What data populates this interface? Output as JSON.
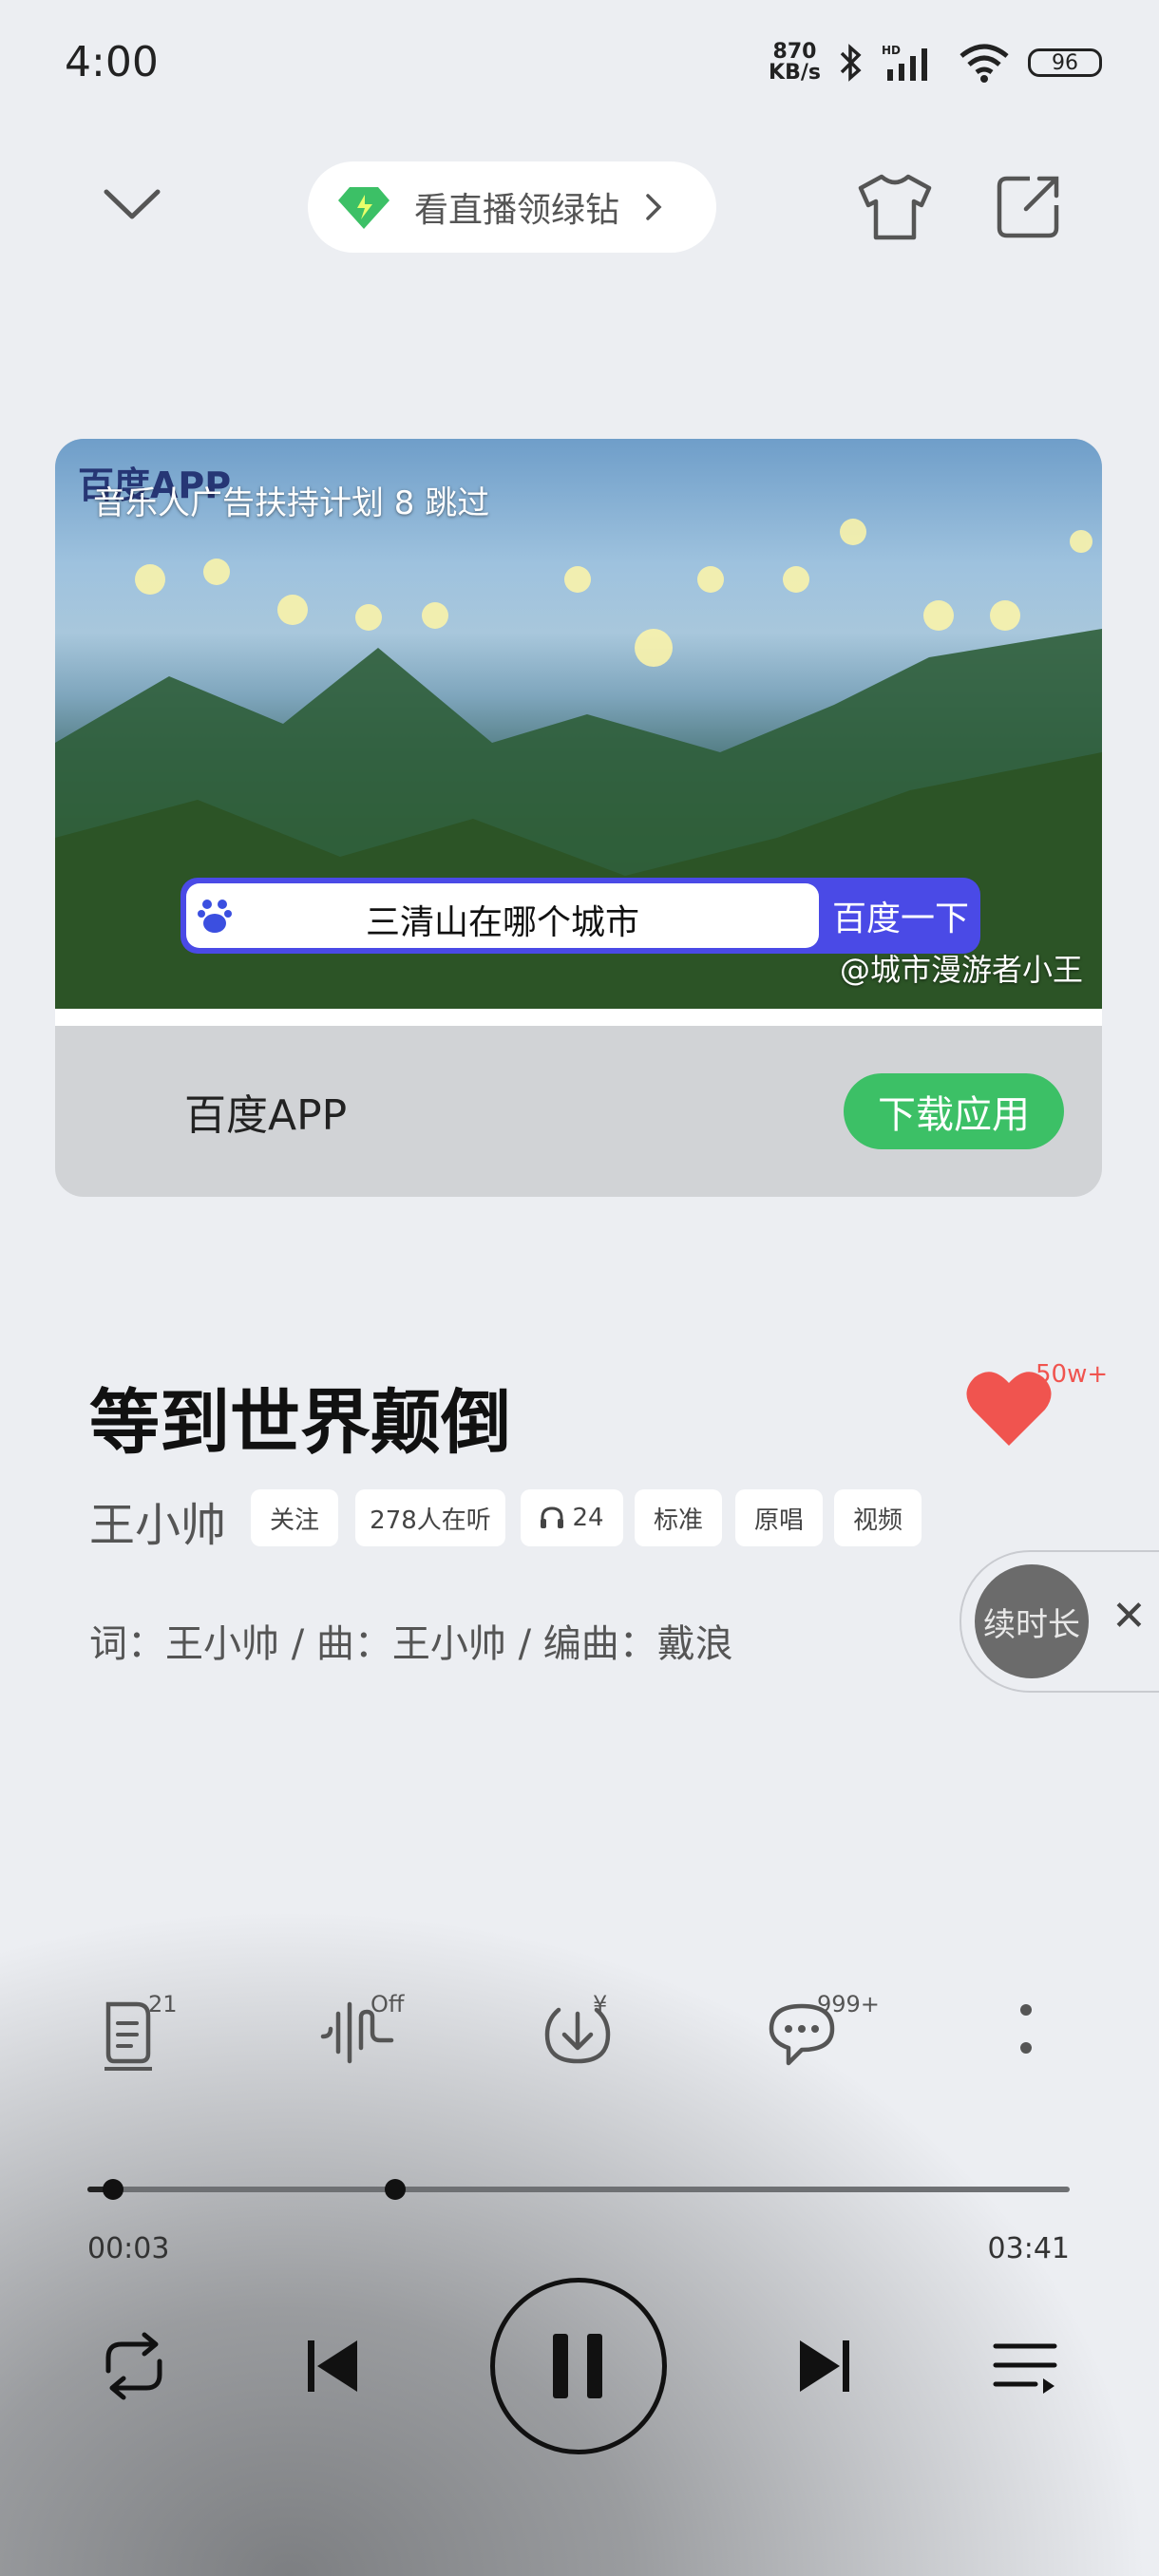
{
  "status_bar": {
    "time": "4:00",
    "speed_value": "870",
    "speed_unit": "KB/s",
    "battery": "96"
  },
  "top_bar": {
    "live_pill_label": "看直播领绿钻"
  },
  "ad": {
    "logo_text": "百度APP",
    "plan_label": "音乐人广告扶持计划 8  跳过",
    "search_query": "三清山在哪个城市",
    "search_button": "百度一下",
    "watermark": "@城市漫游者小王",
    "app_name": "百度APP",
    "download_button": "下载应用"
  },
  "song": {
    "title": "等到世界颠倒",
    "like_count": "50w+",
    "artist": "王小帅",
    "tags": [
      "关注",
      "278人在听",
      "24",
      "标准",
      "原唱",
      "视频"
    ],
    "credits": "词：王小帅 / 曲：王小帅 / 编曲：戴浪"
  },
  "extend_button": {
    "label": "续时长"
  },
  "actions": {
    "lyrics_badge": "21",
    "effect_badge": "Off",
    "download_badge": "¥",
    "comments_badge": "999+"
  },
  "progress": {
    "current": "00:03",
    "total": "03:41",
    "played_fraction": 0.014
  },
  "colors": {
    "accent_green": "#3cc066",
    "heart_red": "#f0544f"
  }
}
